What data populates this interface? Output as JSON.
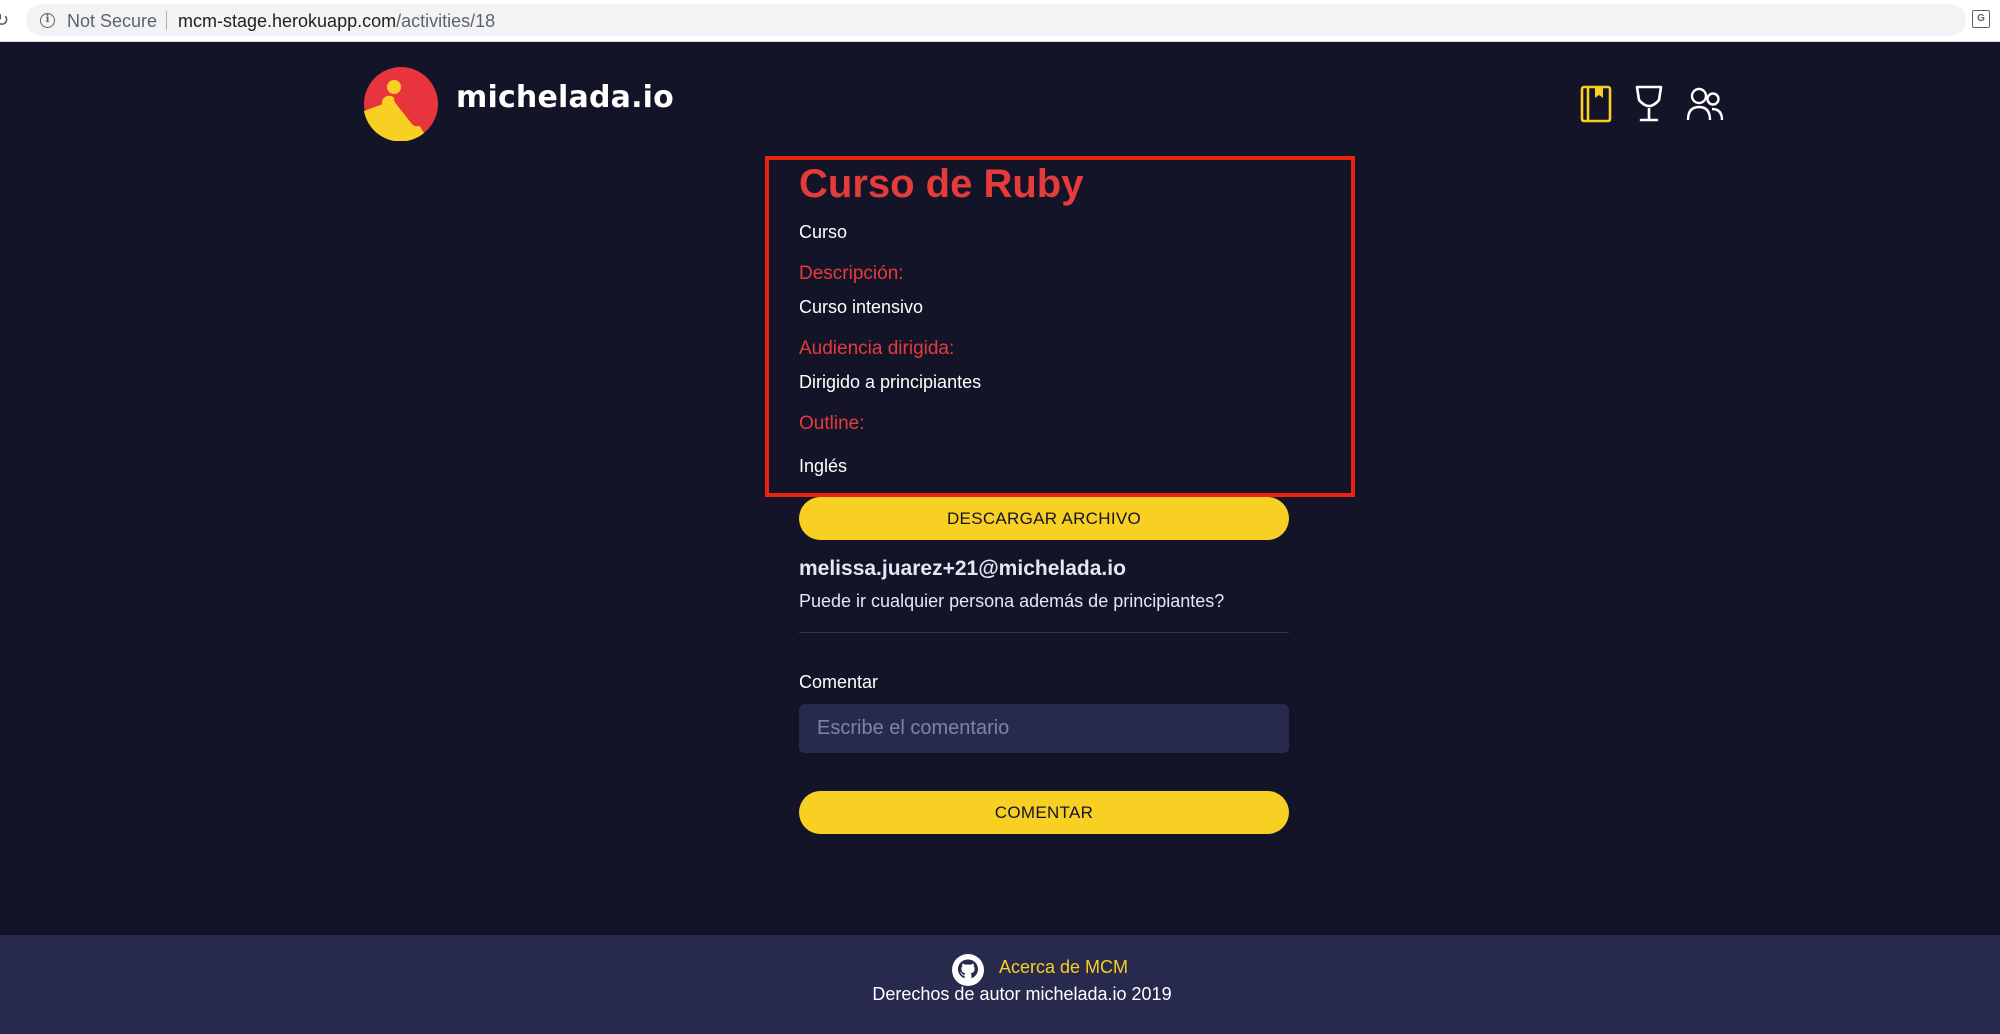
{
  "browser": {
    "security_label": "Not Secure",
    "url_host": "mcm-stage.herokuapp.com",
    "url_path": "/activities/18"
  },
  "header": {
    "brand": "michelada.io",
    "brand_colors": {
      "logo_red": "#e8343c",
      "logo_yellow": "#f8cf23"
    },
    "nav_icons": [
      "book-icon",
      "trophy-icon",
      "users-icon"
    ]
  },
  "activity": {
    "title": "Curso de Ruby",
    "type": "Curso",
    "description_label": "Descripción:",
    "description": "Curso intensivo",
    "audience_label": "Audiencia dirigida:",
    "audience": "Dirigido a principiantes",
    "outline_label": "Outline:",
    "outline": "Inglés",
    "download_button": "DESCARGAR ARCHIVO"
  },
  "comments": [
    {
      "author": "melissa.juarez+21@michelada.io",
      "text": "Puede ir cualquier persona además de principiantes?"
    }
  ],
  "comment_form": {
    "label": "Comentar",
    "placeholder": "Escribe el comentario",
    "submit_button": "COMENTAR"
  },
  "footer": {
    "about_link": "Acerca de MCM",
    "copyright": "Derechos de autor michelada.io 2019"
  },
  "colors": {
    "background": "#141429",
    "accent_yellow": "#f8cf23",
    "accent_red": "#e63b3b",
    "highlight_box": "#e8230e",
    "footer_bg": "#272a4d"
  }
}
